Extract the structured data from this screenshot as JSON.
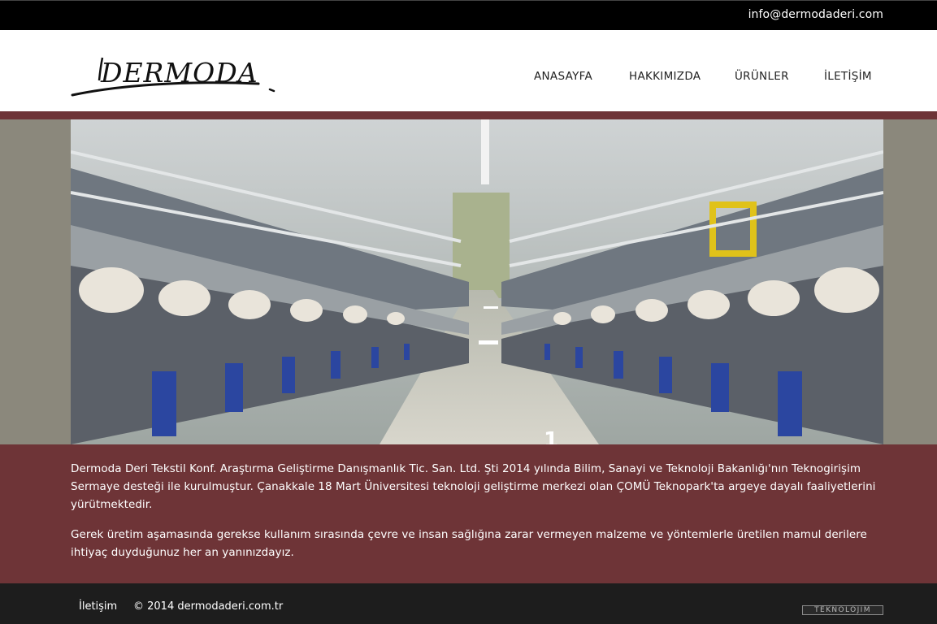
{
  "topbar": {
    "email": "info@dermodaderi.com"
  },
  "header": {
    "logo_text": "DERMODA",
    "nav": [
      "ANASAYFA",
      "HAKKIMIZDA",
      "ÜRÜNLER",
      "İLETİŞİM"
    ]
  },
  "hero": {
    "slide_number": "1",
    "slide_link": "#"
  },
  "content": {
    "paragraph1": "Dermoda Deri Tekstil Konf. Araştırma Geliştirme Danışmanlık Tic. San. Ltd. Şti 2014 yılında Bilim, Sanayi ve Teknoloji Bakanlığı'nın Teknogirişim Sermaye desteği ile kurulmuştur. Çanakkale 18 Mart Üniversitesi teknoloji geliştirme merkezi olan ÇOMÜ Teknopark'ta argeye dayalı faaliyetlerini yürütmektedir.",
    "paragraph2": "Gerek üretim aşamasında gerekse kullanım sırasında çevre ve insan sağlığına zarar vermeyen malzeme ve yöntemlerle üretilen mamul derilere ihtiyaç duyduğunuz her an yanınızdayız."
  },
  "footer": {
    "link": "İletişim",
    "copyright": "© 2014 dermodaderi.com.tr",
    "badge": "TEKNOLOJIM"
  },
  "colors": {
    "topbar": "#000000",
    "accent_maroon": "#6e3437",
    "hero_band": "#8b887c",
    "footer": "#1d1d1d"
  }
}
